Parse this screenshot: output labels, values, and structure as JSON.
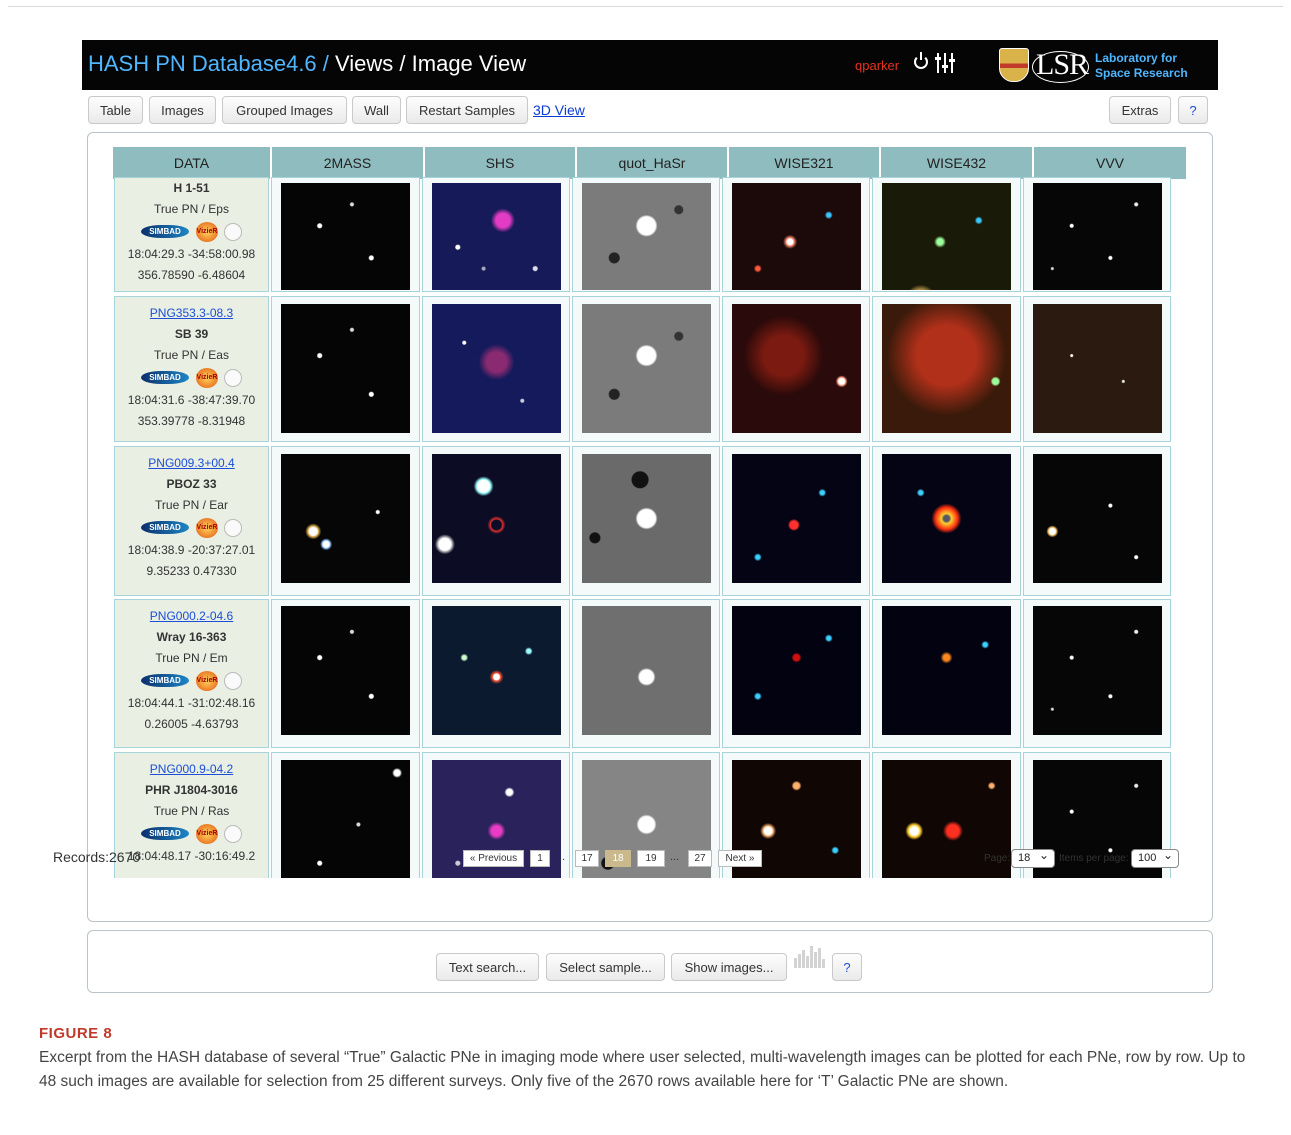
{
  "header": {
    "title_prefix": "HASH PN Database4.6 / ",
    "title_rest": "Views / Image View",
    "user": "qparker",
    "logo_text": "LSR",
    "lab_line1": "Laboratory for",
    "lab_line2": "Space Research"
  },
  "toolbar": {
    "table": "Table",
    "images": "Images",
    "grouped": "Grouped Images",
    "wall": "Wall",
    "restart": "Restart Samples",
    "view3d": "3D View",
    "extras": "Extras",
    "help": "?"
  },
  "columns": [
    "DATA",
    "2MASS",
    "SHS",
    "quot_HaSr",
    "WISE321",
    "WISE432",
    "VVV"
  ],
  "rows": [
    {
      "png": "",
      "name": "H 1-51",
      "type": "True PN / Eps",
      "coords": "18:04:29.3 -34:58:00.98",
      "gal": "356.78590 -6.48604"
    },
    {
      "png": "PNG353.3-08.3",
      "name": "SB 39",
      "type": "True PN / Eas",
      "coords": "18:04:31.6 -38:47:39.70",
      "gal": "353.39778 -8.31948"
    },
    {
      "png": "PNG009.3+00.4",
      "name": "PBOZ 33",
      "type": "True PN / Ear",
      "coords": "18:04:38.9 -20:37:27.01",
      "gal": "9.35233 0.47330"
    },
    {
      "png": "PNG000.2-04.6",
      "name": "Wray 16-363",
      "type": "True PN / Em",
      "coords": "18:04:44.1 -31:02:48.16",
      "gal": "0.26005 -4.63793"
    },
    {
      "png": "PNG000.9-04.2",
      "name": "PHR J1804-3016",
      "type": "True PN / Ras",
      "coords": "18:04:48.17 -30:16:49.2",
      "gal": ""
    }
  ],
  "badges": {
    "simbad": "SIMBAD",
    "vizier": "VizieR"
  },
  "footer": {
    "records": "Records:2670",
    "prev": "« Previous",
    "p1": "1",
    "dots": "...",
    "p17": "17",
    "p18": "18",
    "p19": "19",
    "p27": "27",
    "next": "Next »",
    "page_label": "Page:",
    "page_value": "18",
    "ipp_label": "Items per page:",
    "ipp_value": "100"
  },
  "search": {
    "text_search": "Text search...",
    "select_sample": "Select sample...",
    "show_images": "Show images...",
    "help": "?"
  },
  "caption": {
    "label": "FIGURE 8",
    "text": "Excerpt from the HASH database of several “True” Galactic PNe in imaging mode where user selected, multi-wavelength images can be plotted for each PNe, row by row. Up to 48 such images are available for selection from 25 different surveys. Only five of the 2670 rows available here for ‘T’ Galactic PNe are shown."
  },
  "colors": {
    "header_bg": "#050505",
    "hash_blue": "#4fb6ff",
    "user_red": "#e8321e",
    "table_header": "#8fbcbf",
    "figure_label": "#c0392b"
  },
  "icons": [
    "power-icon",
    "sliders-icon",
    "crest-logo",
    "simbad-logo",
    "vizier-logo",
    "aladin-icon",
    "histogram-icon"
  ]
}
